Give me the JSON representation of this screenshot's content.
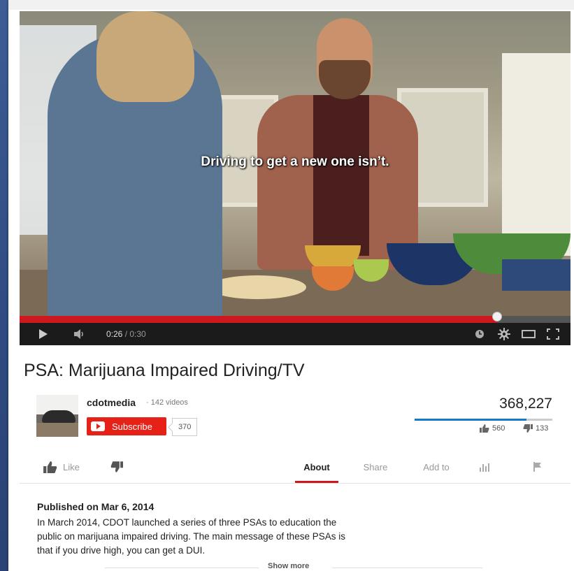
{
  "video": {
    "caption": "Driving to get a new one isn’t.",
    "progress_percent": 86.7
  },
  "player": {
    "current_time": "0:26",
    "duration": "/ 0:30"
  },
  "page": {
    "title": "PSA: Marijuana Impaired Driving/TV"
  },
  "channel": {
    "name": "cdotmedia",
    "videos_count": "· 142 videos",
    "subscribe_label": "Subscribe",
    "subscriber_count": "370"
  },
  "stats": {
    "views": "368,227",
    "likes": "560",
    "dislikes": "133",
    "like_ratio": 0.81
  },
  "actions": {
    "like_label": "Like",
    "tabs": [
      "About",
      "Share",
      "Add to"
    ]
  },
  "description": {
    "published": "Published on Mar 6, 2014",
    "text": "In March 2014, CDOT launched a series of three PSAs to education the public on marijuana impaired driving. The main message of these PSAs is that if you drive high, you can get a DUI.",
    "show_more": "Show more"
  },
  "colors": {
    "accent_red": "#cc181e",
    "subscribe_red": "#e62117",
    "view_bar_blue": "#167ac6"
  }
}
